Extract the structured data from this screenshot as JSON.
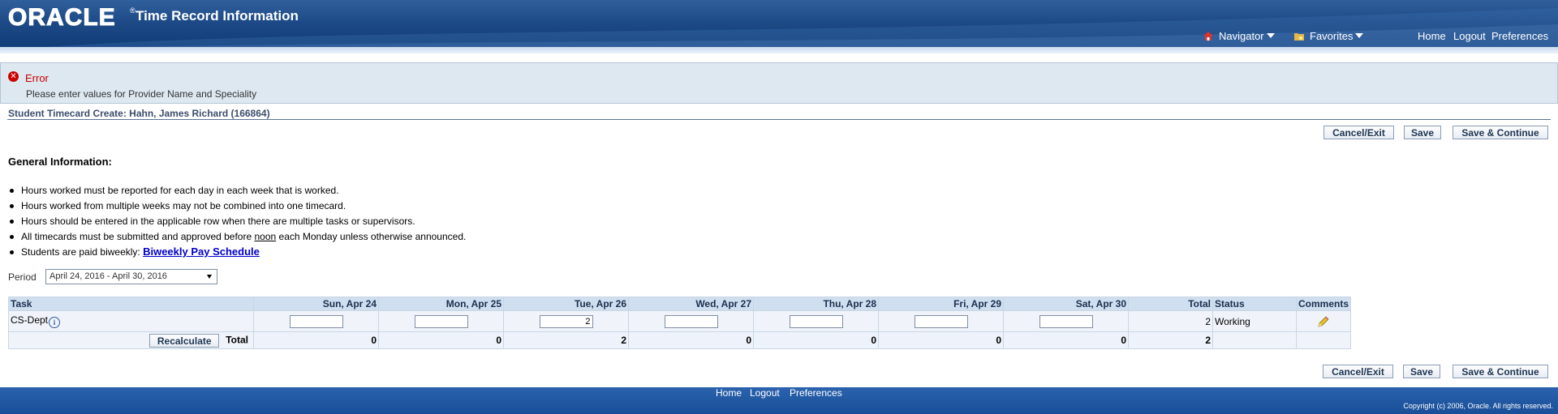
{
  "header": {
    "logo": "ORACLE",
    "logo_reg": "®",
    "app_title": "Time Record Information",
    "navigator_label": "Navigator",
    "favorites_label": "Favorites",
    "home_label": "Home",
    "logout_label": "Logout",
    "preferences_label": "Preferences"
  },
  "error": {
    "title": "Error",
    "message": "Please enter values for Provider Name and Speciality"
  },
  "page_title": "Student Timecard Create: Hahn, James Richard (166864)",
  "buttons": {
    "cancel_exit": "Cancel/Exit",
    "save": "Save",
    "save_continue": "Save & Continue",
    "recalculate": "Recalculate"
  },
  "general_info": {
    "heading": "General Information:",
    "bullets": {
      "b1": "Hours worked must be reported for each day in each week that is worked.",
      "b2": "Hours worked from multiple weeks may not be combined into one timecard.",
      "b3": "Hours should be entered in the applicable row when there are multiple tasks or supervisors.",
      "b4_pre": "All timecards must be submitted and approved before ",
      "b4_noon": "noon",
      "b4_post": " each Monday unless otherwise announced.",
      "b5_pre": "Students are paid biweekly: ",
      "b5_link": "Biweekly Pay Schedule "
    }
  },
  "period": {
    "label": "Period",
    "selected": "April 24, 2016 - April 30, 2016"
  },
  "grid": {
    "headers": {
      "task": "Task",
      "sun": "Sun, Apr 24",
      "mon": "Mon, Apr 25",
      "tue": "Tue, Apr 26",
      "wed": "Wed, Apr 27",
      "thu": "Thu, Apr 28",
      "fri": "Fri, Apr 29",
      "sat": "Sat, Apr 30",
      "total": "Total",
      "status": "Status",
      "comments": "Comments"
    },
    "row": {
      "task": "CS-Dept",
      "sun": "",
      "mon": "",
      "tue": "2",
      "wed": "",
      "thu": "",
      "fri": "",
      "sat": "",
      "total": "2",
      "status": "Working"
    },
    "totals": {
      "label": "Total",
      "sun": "0",
      "mon": "0",
      "tue": "2",
      "wed": "0",
      "thu": "0",
      "fri": "0",
      "sat": "0",
      "total": "2"
    }
  },
  "footer": {
    "home": "Home",
    "logout": "Logout",
    "preferences": "Preferences",
    "copyright": "Copyright (c) 2006, Oracle. All rights reserved."
  },
  "icons": {
    "navigator": "home-icon",
    "favorites": "favorites-folder-icon",
    "error": "error-icon",
    "info": "info-icon",
    "comment": "pencil-icon"
  },
  "colors": {
    "header_blue": "#1d4a86",
    "error_red": "#cc0000",
    "link_blue": "#0000cc",
    "grid_header": "#cfdff0"
  }
}
